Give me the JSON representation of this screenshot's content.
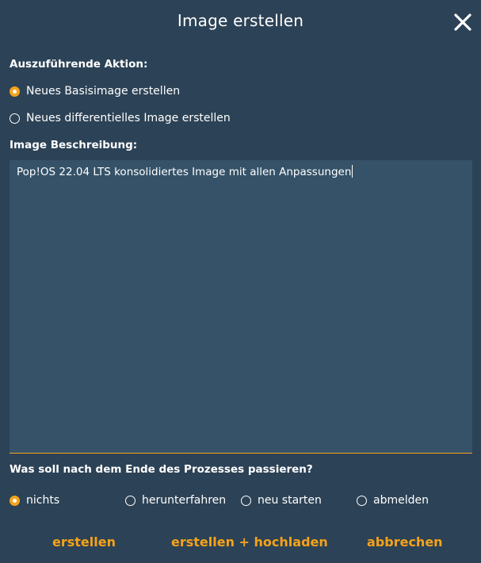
{
  "dialog": {
    "title": "Image erstellen",
    "close_icon": "close-icon"
  },
  "action": {
    "label": "Auszuführende Aktion:",
    "options": [
      {
        "label": "Neues Basisimage erstellen",
        "selected": true
      },
      {
        "label": "Neues differentielles Image erstellen",
        "selected": false
      }
    ]
  },
  "description": {
    "label": "Image Beschreibung:",
    "value": "Pop!OS 22.04 LTS konsolidiertes Image mit allen Anpassungen"
  },
  "after_process": {
    "label": "Was soll nach dem Ende des Prozesses passieren?",
    "options": [
      {
        "label": "nichts",
        "selected": true
      },
      {
        "label": "herunterfahren",
        "selected": false
      },
      {
        "label": "neu starten",
        "selected": false
      },
      {
        "label": "abmelden",
        "selected": false
      }
    ]
  },
  "buttons": {
    "create": "erstellen",
    "create_upload": "erstellen + hochladen",
    "cancel": "abbrechen"
  },
  "colors": {
    "background": "#2c4256",
    "textarea": "#355268",
    "accent": "#f5a31a"
  }
}
